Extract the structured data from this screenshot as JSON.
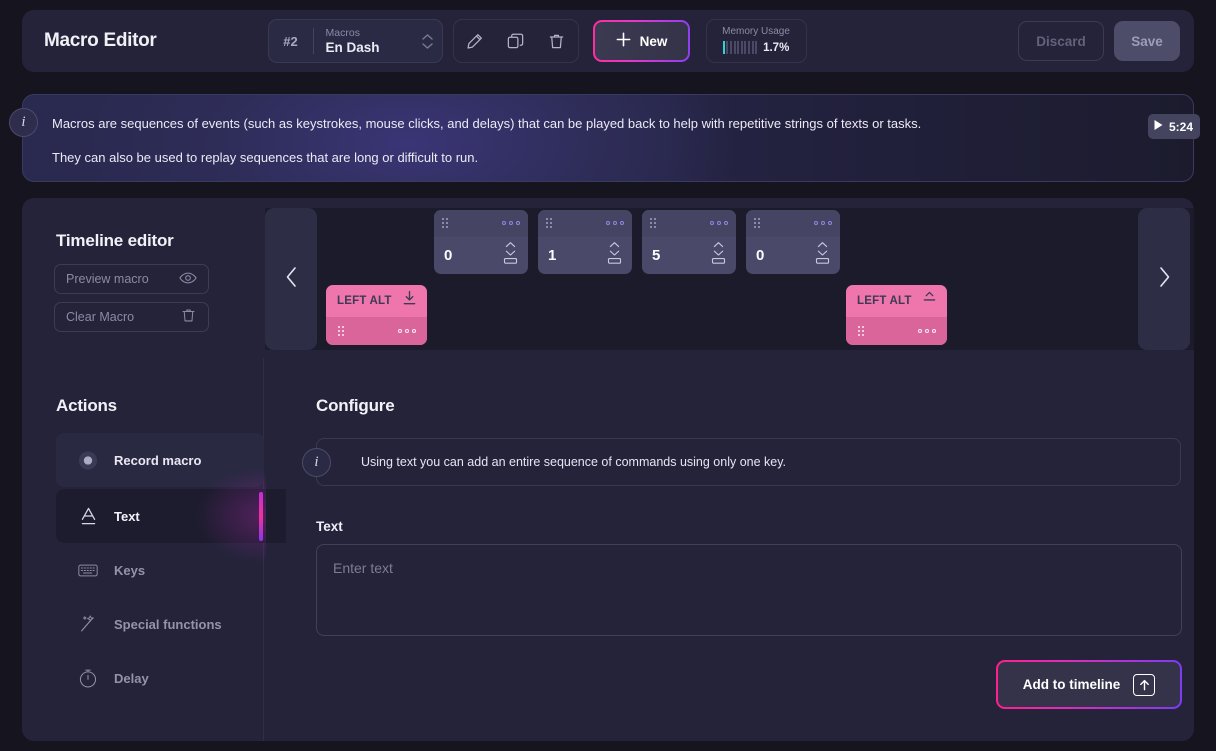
{
  "app": {
    "title": "Macro Editor"
  },
  "header": {
    "macro_selector": {
      "number": "#2",
      "label": "Macros",
      "value": "En Dash"
    },
    "icons": {
      "edit": "pencil-icon",
      "duplicate": "copy-icon",
      "delete": "trash-icon"
    },
    "new_button": "New",
    "memory": {
      "label": "Memory Usage",
      "percent": "1.7%",
      "bars_total": 10,
      "bars_on": 1,
      "accent": "#2fd5d5"
    },
    "discard_button": "Discard",
    "save_button": "Save"
  },
  "banner": {
    "icon": "info-icon",
    "line1": "Macros are sequences of events (such as keystrokes, mouse clicks, and delays) that can be played back to help with repetitive strings of texts or tasks.",
    "line2": "They can also be used to replay sequences that are long or difficult to run.",
    "video_duration": "5:24"
  },
  "timeline": {
    "title": "Timeline editor",
    "preview_button": "Preview macro",
    "clear_button": "Clear Macro",
    "nav_prev": "chevron-left-icon",
    "nav_next": "chevron-right-icon",
    "delay_cards": [
      {
        "value": "0"
      },
      {
        "value": "1"
      },
      {
        "value": "5"
      },
      {
        "value": "0"
      }
    ],
    "key_cards": [
      {
        "name": "LEFT ALT",
        "state": "key-down"
      },
      {
        "name": "LEFT ALT",
        "state": "key-up"
      }
    ]
  },
  "actions": {
    "title": "Actions",
    "items": [
      {
        "label": "Record macro",
        "icon": "record-dot-icon",
        "state": "hover"
      },
      {
        "label": "Text",
        "icon": "text-a-icon",
        "state": "active"
      },
      {
        "label": "Keys",
        "icon": "keyboard-icon",
        "state": "default"
      },
      {
        "label": "Special functions",
        "icon": "magic-wand-icon",
        "state": "default"
      },
      {
        "label": "Delay",
        "icon": "stopwatch-icon",
        "state": "default"
      }
    ],
    "accent": "#f0329a"
  },
  "configure": {
    "title": "Configure",
    "note_icon": "info-icon",
    "note": "Using text you can add an entire sequence of commands using only one key.",
    "field_label": "Text",
    "text_value": "",
    "text_placeholder": "Enter text",
    "add_button": "Add to timeline"
  }
}
